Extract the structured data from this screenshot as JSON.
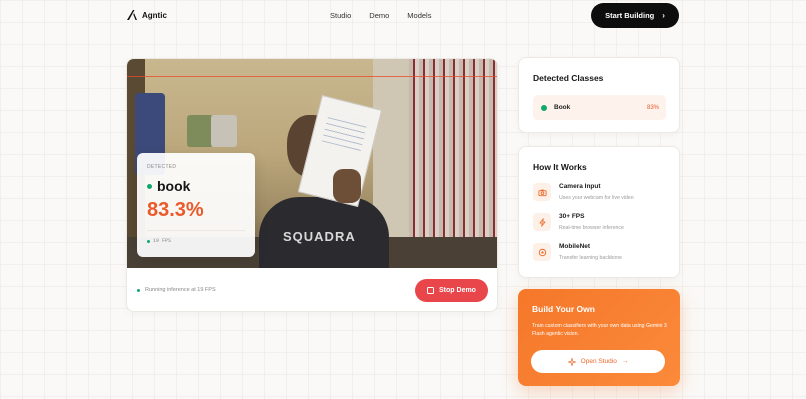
{
  "header": {
    "brand": "Agntic",
    "nav": [
      "Studio",
      "Demo",
      "Models"
    ],
    "cta_label": "Start Building"
  },
  "video": {
    "overlay": {
      "label": "DETECTED",
      "class_name": "book",
      "confidence": "83.3%",
      "fps": "19 FPS"
    },
    "status_text": "Running inference at 19 FPS",
    "stop_label": "Stop Demo",
    "shirt_text": "SQUADRA"
  },
  "detected_classes": {
    "title": "Detected Classes",
    "items": [
      {
        "name": "Book",
        "confidence": "83%"
      }
    ]
  },
  "how_it_works": {
    "title": "How It Works",
    "items": [
      {
        "title": "Camera Input",
        "desc": "Uses your webcam for live video",
        "icon": "camera-icon"
      },
      {
        "title": "30+ FPS",
        "desc": "Real-time browser inference",
        "icon": "bolt-icon"
      },
      {
        "title": "MobileNet",
        "desc": "Transfer learning backbone",
        "icon": "target-icon"
      }
    ]
  },
  "build": {
    "title": "Build Your Own",
    "desc": "Train custom classifiers with your own data using Gemini 3 Flash agentic vision.",
    "button_label": "Open Studio"
  },
  "colors": {
    "accent": "#ea5a2a",
    "green": "#10a86b",
    "stop": "#e8464a",
    "build_gradient_start": "#f5772a"
  }
}
